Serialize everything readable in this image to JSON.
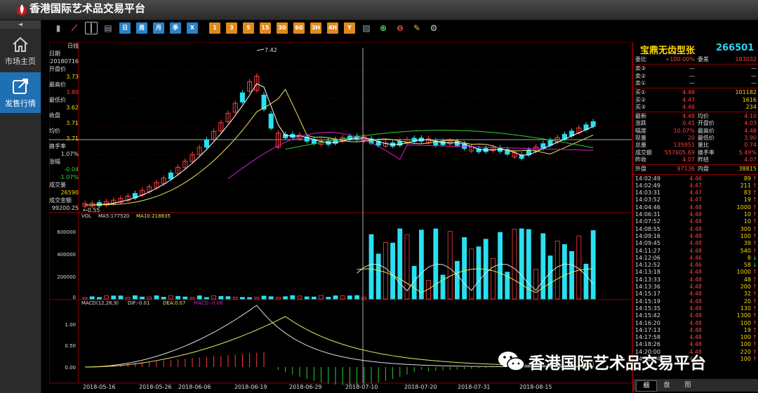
{
  "app": {
    "title": "香港国际艺术品交易平台"
  },
  "nav": {
    "collapse": "◄",
    "items": [
      {
        "label": "市场主页",
        "icon": "home-icon"
      },
      {
        "label": "发售行情",
        "icon": "external-link-icon",
        "active": true
      }
    ]
  },
  "toolbar": {
    "buttons": [
      "bar-chart-icon",
      "line-chart-icon",
      "candlestick-icon",
      "calendar-icon",
      "日",
      "周",
      "月",
      "季",
      "X",
      "1",
      "3",
      "5",
      "15",
      "30",
      "60",
      "3H",
      "4H",
      "Y",
      "ruler-icon",
      "zoom-in-icon",
      "zoom-out-icon",
      "draw-icon",
      "settings-icon"
    ]
  },
  "info": {
    "period": "日线",
    "rows": [
      {
        "label": "日期",
        "value": "20180716",
        "color": "#dddddd"
      },
      {
        "label": "开盘价",
        "value": "3.73",
        "color": "#ffd700"
      },
      {
        "label": "最高价",
        "value": "3.80",
        "color": "#ff4040"
      },
      {
        "label": "最低价",
        "value": "3.62",
        "color": "#ffd700"
      },
      {
        "label": "收盘",
        "value": "3.71",
        "color": "#ffd700"
      },
      {
        "label": "均价",
        "value": "3.71",
        "color": "#ffd700"
      },
      {
        "label": "换手率",
        "value": "1.07%",
        "color": "#dddddd"
      },
      {
        "label": "涨幅",
        "value": "-0.04",
        "color": "#3cd23c"
      },
      {
        "label": "",
        "value": "-1.07%",
        "color": "#3cd23c"
      },
      {
        "label": "成交量",
        "value": "26590",
        "color": "#ffd700"
      },
      {
        "label": "成交金额",
        "value": "99200.25",
        "color": "#dddddd"
      }
    ]
  },
  "chart_data": {
    "type": "candlestick",
    "price": {
      "high_label": "7.42",
      "low_label": "0.55"
    },
    "volume": {
      "label": "VOL",
      "ma5_label": "MA5:177520",
      "ma10_label": "MA10:218835",
      "yticks": [
        "600000",
        "400000",
        "200000",
        "0"
      ]
    },
    "macd": {
      "label": "MACD(12,26,9)",
      "dif_label": "DIF:-0.01",
      "dea_label": "DEA:0.07",
      "macd_label": "MACD:-0.08",
      "yticks": [
        "1.00",
        "0.50",
        "0.00"
      ]
    },
    "xlabels": [
      "2018-05-16",
      "2018-05-26",
      "2018-06-06",
      "2018-06-19",
      "2018-06-29",
      "2018-07-10",
      "2018-07-20",
      "2018-07-31",
      "2018-08-15"
    ],
    "colors": {
      "up": "#ff4040",
      "down": "#28e0f0",
      "ma5": "#ffffff",
      "ma10": "#e8e85a",
      "ma20": "#d020d0",
      "ma60": "#30d030"
    }
  },
  "right": {
    "name": "宝鼎无齿型张",
    "code": "266501",
    "top_rows": [
      {
        "l": "委比",
        "m": "+100.00%",
        "ml": "委差",
        "r": "183032",
        "c": "#ff4040"
      }
    ],
    "sells": [
      {
        "l": "卖③",
        "m": "—",
        "r": "—"
      },
      {
        "l": "卖②",
        "m": "—",
        "r": "—"
      },
      {
        "l": "卖①",
        "m": "—",
        "r": "—"
      }
    ],
    "buys": [
      {
        "l": "买①",
        "m": "4.48",
        "r": "101182"
      },
      {
        "l": "买②",
        "m": "4.47",
        "r": "1616"
      },
      {
        "l": "买③",
        "m": "4.46",
        "r": "234"
      }
    ],
    "stats": [
      {
        "a": "最新",
        "b": "4.48",
        "c": "均价",
        "d": "4.10"
      },
      {
        "a": "涨跌",
        "b": "0.41",
        "c": "开盘价",
        "d": "4.03"
      },
      {
        "a": "幅度",
        "b": "10.07%",
        "c": "最高价",
        "d": "4.48"
      },
      {
        "a": "现量",
        "b": "20",
        "c": "最低价",
        "d": "3.90"
      },
      {
        "a": "总量",
        "b": "135951",
        "c": "量比",
        "d": "0.74"
      },
      {
        "a": "成交额",
        "b": "557605.69",
        "c": "换手率",
        "d": "5.49%"
      },
      {
        "a": "昨收",
        "b": "4.07",
        "c": "昨结",
        "d": "4.07"
      }
    ],
    "outer": {
      "a": "外盘",
      "b": "97136",
      "c": "内盘",
      "d": "38815"
    },
    "ticks": [
      {
        "t": "14:02:49",
        "p": "4.46",
        "v": "89",
        "d": "↑"
      },
      {
        "t": "14:02:49",
        "p": "4.47",
        "v": "211",
        "d": "↑"
      },
      {
        "t": "14:03:31",
        "p": "4.47",
        "v": "83",
        "d": "↑"
      },
      {
        "t": "14:03:52",
        "p": "4.47",
        "v": "19",
        "d": "↑"
      },
      {
        "t": "14:04:46",
        "p": "4.48",
        "v": "1000",
        "d": "↑"
      },
      {
        "t": "14:06:31",
        "p": "4.48",
        "v": "10",
        "d": "↑"
      },
      {
        "t": "14:07:52",
        "p": "4.48",
        "v": "10",
        "d": "↑"
      },
      {
        "t": "14:08:55",
        "p": "4.48",
        "v": "300",
        "d": "↑"
      },
      {
        "t": "14:09:16",
        "p": "4.48",
        "v": "100",
        "d": "↑"
      },
      {
        "t": "14:09:45",
        "p": "4.48",
        "v": "39",
        "d": "↑"
      },
      {
        "t": "14:11:27",
        "p": "4.48",
        "v": "540",
        "d": "↑"
      },
      {
        "t": "14:12:06",
        "p": "4.46",
        "v": "8",
        "d": "↓"
      },
      {
        "t": "14:12:52",
        "p": "4.46",
        "v": "58",
        "d": "↓"
      },
      {
        "t": "14:13:18",
        "p": "4.48",
        "v": "1000",
        "d": "↑"
      },
      {
        "t": "14:13:33",
        "p": "4.48",
        "v": "48",
        "d": "↑"
      },
      {
        "t": "14:13:36",
        "p": "4.48",
        "v": "200",
        "d": "↑"
      },
      {
        "t": "14:15:17",
        "p": "4.48",
        "v": "32",
        "d": "↑"
      },
      {
        "t": "14:15:19",
        "p": "4.48",
        "v": "20",
        "d": "↑"
      },
      {
        "t": "14:15:35",
        "p": "4.48",
        "v": "130",
        "d": "↑"
      },
      {
        "t": "14:15:42",
        "p": "4.48",
        "v": "1300",
        "d": "↑"
      },
      {
        "t": "14:16:20",
        "p": "4.48",
        "v": "100",
        "d": "↑"
      },
      {
        "t": "14:17:13",
        "p": "4.48",
        "v": "19",
        "d": "↑"
      },
      {
        "t": "14:17:58",
        "p": "4.48",
        "v": "100",
        "d": "↑"
      },
      {
        "t": "14:18:26",
        "p": "4.48",
        "v": "100",
        "d": "↑"
      },
      {
        "t": "14:20:00",
        "p": "4.48",
        "v": "220",
        "d": "↑"
      },
      {
        "t": "14:22:34",
        "p": "4.48",
        "v": "100",
        "d": "↑"
      }
    ],
    "tabs": [
      "细",
      "盘",
      "图"
    ]
  },
  "watermark": {
    "text": "香港国际艺术品交易平台"
  }
}
